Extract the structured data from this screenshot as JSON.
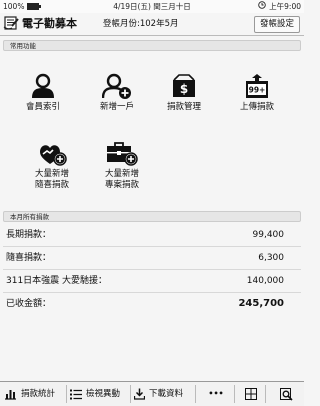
{
  "status_bar": {
    "battery": "100%",
    "battery_level": 1.0,
    "date": "4/19日(五) 閏三月十日",
    "time": "上午9:00"
  },
  "header": {
    "title": "電子勸募本",
    "month_label": "登帳月份:102年5月",
    "settings_label": "發帳設定"
  },
  "shortcuts": {
    "section_title": "常用功能",
    "items": [
      {
        "label": "會員索引",
        "icon": "member-index-icon"
      },
      {
        "label": "新增一戶",
        "icon": "add-household-icon"
      },
      {
        "label": "捐款管理",
        "icon": "donation-manage-icon"
      },
      {
        "label": "上傳捐款",
        "icon": "upload-donation-icon",
        "badge": "99+"
      },
      {
        "label_line1": "大量新增",
        "label_line2": "隨喜捐款",
        "icon": "bulk-add-casual-icon"
      },
      {
        "label_line1": "大量新增",
        "label_line2": "專案捐款",
        "icon": "bulk-add-project-icon"
      }
    ]
  },
  "summary": {
    "section_title": "本月所有捐款",
    "rows": [
      {
        "label": "長期捐款：",
        "value": "99,400"
      },
      {
        "label": "隨喜捐款：",
        "value": "6,300"
      },
      {
        "label": "311日本強震 大愛馳援：",
        "value": "140,000"
      }
    ],
    "total": {
      "label": "已收金額：",
      "value": "245,700"
    }
  },
  "bottom_bar": {
    "stats_label": "捐款統計",
    "review_label": "檢視異動",
    "download_label": "下載資料",
    "more_label": "•••"
  }
}
